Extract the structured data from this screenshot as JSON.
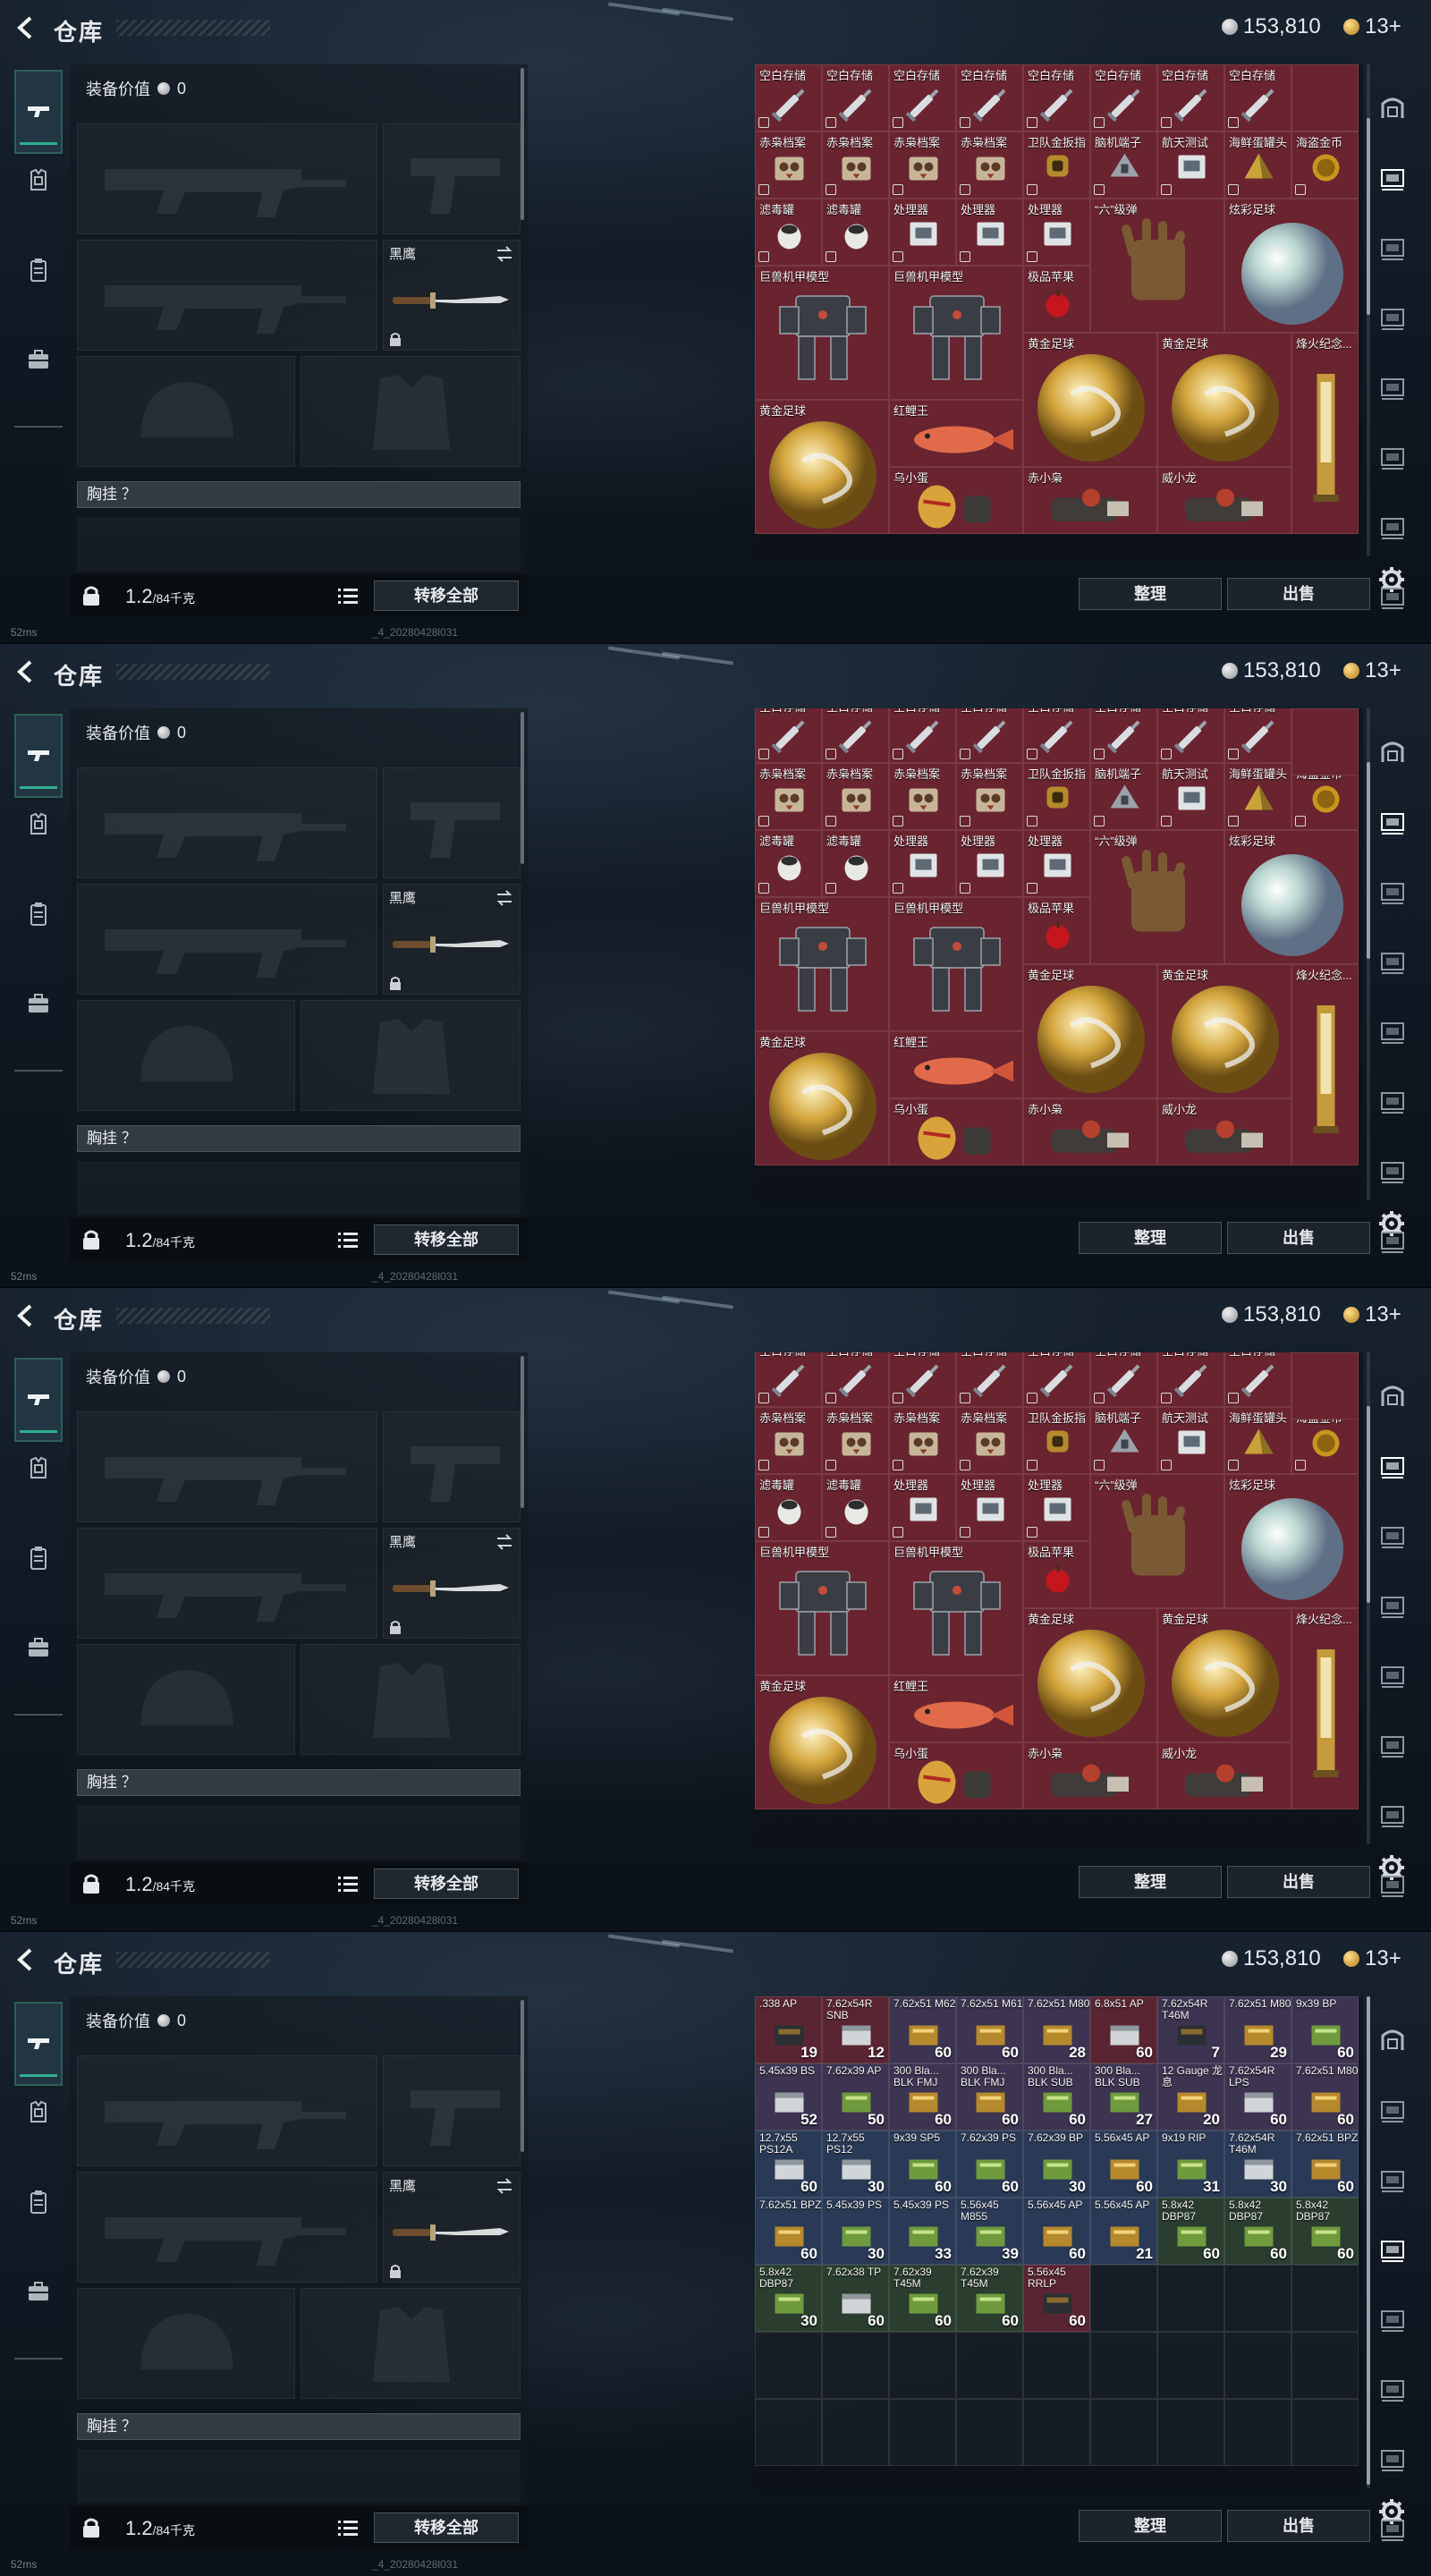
{
  "header": {
    "title": "仓库",
    "silver": "153,810",
    "gold": "13+"
  },
  "left": {
    "equip_value_label": "装备价值",
    "equip_value": "0",
    "knife_label": "黑鹰",
    "chest_label": "胸挂 ？",
    "weight": "1.2",
    "weight_max": "/84千克",
    "transfer_all": "转移全部"
  },
  "buttons": {
    "sort": "整理",
    "sell": "出售"
  },
  "status": {
    "ping": "52ms",
    "build": "_4_20280428l031"
  },
  "icons": {
    "left_rail": [
      "gun-icon",
      "armor-icon",
      "clipboard-icon",
      "briefcase-icon"
    ],
    "right_rail": [
      "safe-icon",
      "stash-tab-1-icon",
      "stash-tab-2-icon",
      "stash-tab-3-icon",
      "stash-tab-4-icon",
      "stash-tab-5-icon",
      "stash-tab-6-icon",
      "stash-tab-7-icon"
    ]
  },
  "stash_items": [
    {
      "name": "空白存储",
      "row": 0,
      "col": 0,
      "w": 1,
      "h": 1,
      "art": "syringe",
      "color": "#6a2430"
    },
    {
      "name": "空白存储",
      "row": 0,
      "col": 1,
      "w": 1,
      "h": 1,
      "art": "syringe",
      "color": "#6a2430"
    },
    {
      "name": "空白存储",
      "row": 0,
      "col": 2,
      "w": 1,
      "h": 1,
      "art": "syringe",
      "color": "#6a2430"
    },
    {
      "name": "空白存储",
      "row": 0,
      "col": 3,
      "w": 1,
      "h": 1,
      "art": "syringe",
      "color": "#6a2430"
    },
    {
      "name": "空白存储",
      "row": 0,
      "col": 4,
      "w": 1,
      "h": 1,
      "art": "syringe",
      "color": "#6a2430"
    },
    {
      "name": "空白存储",
      "row": 0,
      "col": 5,
      "w": 1,
      "h": 1,
      "art": "syringe",
      "color": "#6a2430"
    },
    {
      "name": "空白存储",
      "row": 0,
      "col": 6,
      "w": 1,
      "h": 1,
      "art": "syringe",
      "color": "#6a2430"
    },
    {
      "name": "空白存储",
      "row": 0,
      "col": 7,
      "w": 1,
      "h": 1,
      "art": "syringe",
      "color": "#6a2430"
    },
    {
      "name": "赤枭档案",
      "row": 1,
      "col": 0,
      "w": 1,
      "h": 1,
      "art": "owl",
      "color": "#6a2430"
    },
    {
      "name": "赤枭档案",
      "row": 1,
      "col": 1,
      "w": 1,
      "h": 1,
      "art": "owl",
      "color": "#6a2430"
    },
    {
      "name": "赤枭档案",
      "row": 1,
      "col": 2,
      "w": 1,
      "h": 1,
      "art": "owl",
      "color": "#6a2430"
    },
    {
      "name": "赤枭档案",
      "row": 1,
      "col": 3,
      "w": 1,
      "h": 1,
      "art": "owl",
      "color": "#6a2430"
    },
    {
      "name": "卫队金扳指",
      "row": 1,
      "col": 4,
      "w": 1,
      "h": 1,
      "art": "ring",
      "color": "#6a2430"
    },
    {
      "name": "脑机端子",
      "row": 1,
      "col": 5,
      "w": 1,
      "h": 1,
      "art": "chip",
      "color": "#6a2430"
    },
    {
      "name": "航天测试",
      "row": 1,
      "col": 6,
      "w": 1,
      "h": 1,
      "art": "box",
      "color": "#6a2430"
    },
    {
      "name": "海鲜蛋罐头",
      "row": 1,
      "col": 7,
      "w": 1,
      "h": 1,
      "art": "pyramid",
      "color": "#6a2430"
    },
    {
      "name": "海盗金币",
      "row": 1,
      "col": 8,
      "w": 1,
      "h": 1,
      "art": "coin",
      "color": "#6a2430"
    },
    {
      "name": "滤毒罐",
      "row": 2,
      "col": 0,
      "w": 1,
      "h": 1,
      "art": "canister",
      "color": "#6a2430"
    },
    {
      "name": "滤毒罐",
      "row": 2,
      "col": 1,
      "w": 1,
      "h": 1,
      "art": "canister",
      "color": "#6a2430"
    },
    {
      "name": "处理器",
      "row": 2,
      "col": 2,
      "w": 1,
      "h": 1,
      "art": "box",
      "color": "#6a2430"
    },
    {
      "name": "处理器",
      "row": 2,
      "col": 3,
      "w": 1,
      "h": 1,
      "art": "box",
      "color": "#6a2430"
    },
    {
      "name": "处理器",
      "row": 2,
      "col": 4,
      "w": 1,
      "h": 1,
      "art": "box",
      "color": "#6a2430"
    },
    {
      "name": "“六”级弹",
      "row": 2,
      "col": 5,
      "w": 2,
      "h": 2,
      "art": "hand",
      "color": "#6a2430"
    },
    {
      "name": "炫彩足球",
      "row": 2,
      "col": 7,
      "w": 2,
      "h": 2,
      "art": "orb",
      "color": "#6a2430"
    },
    {
      "name": "巨兽机甲模型",
      "row": 3,
      "col": 0,
      "w": 2,
      "h": 2,
      "art": "mech",
      "color": "#6a2430"
    },
    {
      "name": "巨兽机甲模型",
      "row": 3,
      "col": 2,
      "w": 2,
      "h": 2,
      "art": "mech",
      "color": "#6a2430"
    },
    {
      "name": "极品苹果",
      "row": 3,
      "col": 4,
      "w": 1,
      "h": 1,
      "art": "apple",
      "color": "#6a2430"
    },
    {
      "name": "黄金足球",
      "row": 4,
      "col": 4,
      "w": 2,
      "h": 2,
      "art": "goldball",
      "color": "#6a2430"
    },
    {
      "name": "黄金足球",
      "row": 4,
      "col": 6,
      "w": 2,
      "h": 2,
      "art": "goldball",
      "color": "#6a2430"
    },
    {
      "name": "烽火纪念...",
      "row": 4,
      "col": 8,
      "w": 1,
      "h": 3,
      "art": "trophy",
      "color": "#6a2430"
    },
    {
      "name": "黄金足球",
      "row": 5,
      "col": 0,
      "w": 2,
      "h": 2,
      "art": "goldball",
      "color": "#6a2430"
    },
    {
      "name": "红鲤王",
      "row": 5,
      "col": 2,
      "w": 2,
      "h": 1,
      "art": "fish",
      "color": "#6a2430"
    },
    {
      "name": "乌小蛋",
      "row": 6,
      "col": 2,
      "w": 2,
      "h": 1,
      "art": "egg",
      "color": "#6a2430"
    },
    {
      "name": "赤小枭",
      "row": 6,
      "col": 4,
      "w": 2,
      "h": 1,
      "art": "figure",
      "color": "#6a2430"
    },
    {
      "name": "威小龙",
      "row": 6,
      "col": 6,
      "w": 2,
      "h": 1,
      "art": "figure",
      "color": "#6a2430"
    }
  ],
  "ammo_items": [
    {
      "name": ".338 AP",
      "qty": "19",
      "row": 0,
      "col": 0,
      "art": "ammo-dark",
      "color": "#5a2532"
    },
    {
      "name": "7.62x54R SNB",
      "qty": "12",
      "row": 0,
      "col": 1,
      "art": "ammo-box",
      "color": "#5a2532"
    },
    {
      "name": "7.62x51 M62",
      "qty": "60",
      "row": 0,
      "col": 2,
      "art": "ammo-gold",
      "color": "#3c3450"
    },
    {
      "name": "7.62x51 M61",
      "qty": "60",
      "row": 0,
      "col": 3,
      "art": "ammo-gold",
      "color": "#3c3450"
    },
    {
      "name": "7.62x51 M80",
      "qty": "28",
      "row": 0,
      "col": 4,
      "art": "ammo-gold",
      "color": "#3c3450"
    },
    {
      "name": "6.8x51 AP",
      "qty": "60",
      "row": 0,
      "col": 5,
      "art": "ammo-box",
      "color": "#5a2532"
    },
    {
      "name": "7.62x54R T46M",
      "qty": "7",
      "row": 0,
      "col": 6,
      "art": "ammo-dark",
      "color": "#3c3450"
    },
    {
      "name": "7.62x51 M80",
      "qty": "29",
      "row": 0,
      "col": 7,
      "art": "ammo-gold",
      "color": "#3c3450"
    },
    {
      "name": "9x39 BP",
      "qty": "60",
      "row": 0,
      "col": 8,
      "art": "ammo-green",
      "color": "#3c3450"
    },
    {
      "name": "5.45x39 BS",
      "qty": "52",
      "row": 1,
      "col": 0,
      "art": "ammo-box",
      "color": "#3c3450"
    },
    {
      "name": "7.62x39 AP",
      "qty": "50",
      "row": 1,
      "col": 1,
      "art": "ammo-green",
      "color": "#3c3450"
    },
    {
      "name": "300 Bla... BLK FMJ",
      "qty": "60",
      "row": 1,
      "col": 2,
      "art": "ammo-gold",
      "color": "#3c3450"
    },
    {
      "name": "300 Bla... BLK FMJ",
      "qty": "60",
      "row": 1,
      "col": 3,
      "art": "ammo-gold",
      "color": "#3c3450"
    },
    {
      "name": "300 Bla... BLK SUB",
      "qty": "60",
      "row": 1,
      "col": 4,
      "art": "ammo-green",
      "color": "#3c3450"
    },
    {
      "name": "300 Bla... BLK SUB",
      "qty": "27",
      "row": 1,
      "col": 5,
      "art": "ammo-green",
      "color": "#3c3450"
    },
    {
      "name": "12 Gauge 龙息",
      "qty": "20",
      "row": 1,
      "col": 6,
      "art": "ammo-gold",
      "color": "#3c3450"
    },
    {
      "name": "7.62x54R LPS",
      "qty": "60",
      "row": 1,
      "col": 7,
      "art": "ammo-box",
      "color": "#3c3450"
    },
    {
      "name": "7.62x51 M80",
      "qty": "60",
      "row": 1,
      "col": 8,
      "art": "ammo-gold",
      "color": "#3c3450"
    },
    {
      "name": "12.7x55 PS12A",
      "qty": "60",
      "row": 2,
      "col": 0,
      "art": "ammo-box",
      "color": "#2a3a56"
    },
    {
      "name": "12.7x55 PS12",
      "qty": "30",
      "row": 2,
      "col": 1,
      "art": "ammo-box",
      "color": "#2a3a56"
    },
    {
      "name": "9x39 SP5",
      "qty": "60",
      "row": 2,
      "col": 2,
      "art": "ammo-green",
      "color": "#2a3a56"
    },
    {
      "name": "7.62x39 PS",
      "qty": "60",
      "row": 2,
      "col": 3,
      "art": "ammo-green",
      "color": "#2a3a56"
    },
    {
      "name": "7.62x39 BP",
      "qty": "30",
      "row": 2,
      "col": 4,
      "art": "ammo-green",
      "color": "#2a3a56"
    },
    {
      "name": "5.56x45 AP",
      "qty": "60",
      "row": 2,
      "col": 5,
      "art": "ammo-gold",
      "color": "#2a3a56"
    },
    {
      "name": "9x19 RIP",
      "qty": "31",
      "row": 2,
      "col": 6,
      "art": "ammo-green",
      "color": "#2a3a56"
    },
    {
      "name": "7.62x54R T46M",
      "qty": "30",
      "row": 2,
      "col": 7,
      "art": "ammo-box",
      "color": "#2a3a56"
    },
    {
      "name": "7.62x51 BPZ",
      "qty": "60",
      "row": 2,
      "col": 8,
      "art": "ammo-gold",
      "color": "#2a3a56"
    },
    {
      "name": "7.62x51 BPZ",
      "qty": "60",
      "row": 3,
      "col": 0,
      "art": "ammo-gold",
      "color": "#2a3a56"
    },
    {
      "name": "5.45x39 PS",
      "qty": "30",
      "row": 3,
      "col": 1,
      "art": "ammo-green",
      "color": "#2a3a56"
    },
    {
      "name": "5.45x39 PS",
      "qty": "33",
      "row": 3,
      "col": 2,
      "art": "ammo-green",
      "color": "#2a3a56"
    },
    {
      "name": "5.56x45 M855",
      "qty": "39",
      "row": 3,
      "col": 3,
      "art": "ammo-green",
      "color": "#2a3a56"
    },
    {
      "name": "5.56x45 AP",
      "qty": "60",
      "row": 3,
      "col": 4,
      "art": "ammo-gold",
      "color": "#2a3a56"
    },
    {
      "name": "5.56x45 AP",
      "qty": "21",
      "row": 3,
      "col": 5,
      "art": "ammo-gold",
      "color": "#2a3a56"
    },
    {
      "name": "5.8x42 DBP87",
      "qty": "60",
      "row": 3,
      "col": 6,
      "art": "ammo-green",
      "color": "#2a3d2e"
    },
    {
      "name": "5.8x42 DBP87",
      "qty": "60",
      "row": 3,
      "col": 7,
      "art": "ammo-green",
      "color": "#2a3d2e"
    },
    {
      "name": "5.8x42 DBP87",
      "qty": "60",
      "row": 3,
      "col": 8,
      "art": "ammo-green",
      "color": "#2a3d2e"
    },
    {
      "name": "5.8x42 DBP87",
      "qty": "30",
      "row": 4,
      "col": 0,
      "art": "ammo-green",
      "color": "#2a3d2e"
    },
    {
      "name": "7.62x38 TP",
      "qty": "60",
      "row": 4,
      "col": 1,
      "art": "ammo-box",
      "color": "#2a3d2e"
    },
    {
      "name": "7.62x39 T45M",
      "qty": "60",
      "row": 4,
      "col": 2,
      "art": "ammo-green",
      "color": "#2a3d2e"
    },
    {
      "name": "7.62x39 T45M",
      "qty": "60",
      "row": 4,
      "col": 3,
      "art": "ammo-green",
      "color": "#2a3d2e"
    },
    {
      "name": "5.56x45 RRLP",
      "qty": "60",
      "row": 4,
      "col": 4,
      "art": "ammo-dark",
      "color": "#5a2532"
    }
  ]
}
